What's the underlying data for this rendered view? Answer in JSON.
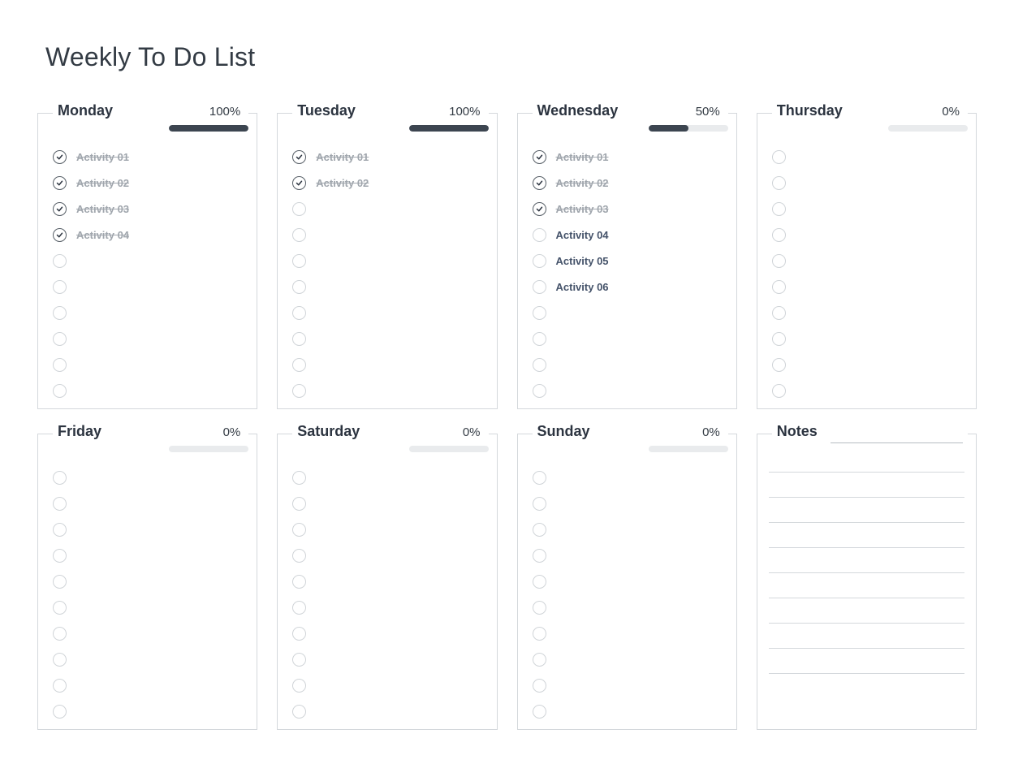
{
  "title": "Weekly To Do List",
  "notes_label": "Notes",
  "days": [
    {
      "name": "Monday",
      "percent": "100%",
      "progress": 100,
      "tasks": [
        {
          "label": "Activity 01",
          "done": true
        },
        {
          "label": "Activity 02",
          "done": true
        },
        {
          "label": "Activity 03",
          "done": true
        },
        {
          "label": "Activity 04",
          "done": true
        },
        {
          "label": "",
          "done": false
        },
        {
          "label": "",
          "done": false
        },
        {
          "label": "",
          "done": false
        },
        {
          "label": "",
          "done": false
        },
        {
          "label": "",
          "done": false
        },
        {
          "label": "",
          "done": false
        }
      ]
    },
    {
      "name": "Tuesday",
      "percent": "100%",
      "progress": 100,
      "tasks": [
        {
          "label": "Activity 01",
          "done": true
        },
        {
          "label": "Activity 02",
          "done": true
        },
        {
          "label": "",
          "done": false
        },
        {
          "label": "",
          "done": false
        },
        {
          "label": "",
          "done": false
        },
        {
          "label": "",
          "done": false
        },
        {
          "label": "",
          "done": false
        },
        {
          "label": "",
          "done": false
        },
        {
          "label": "",
          "done": false
        },
        {
          "label": "",
          "done": false
        }
      ]
    },
    {
      "name": "Wednesday",
      "percent": "50%",
      "progress": 50,
      "tasks": [
        {
          "label": "Activity 01",
          "done": true
        },
        {
          "label": "Activity 02",
          "done": true
        },
        {
          "label": "Activity 03",
          "done": true
        },
        {
          "label": "Activity 04",
          "done": false
        },
        {
          "label": "Activity 05",
          "done": false
        },
        {
          "label": "Activity 06",
          "done": false
        },
        {
          "label": "",
          "done": false
        },
        {
          "label": "",
          "done": false
        },
        {
          "label": "",
          "done": false
        },
        {
          "label": "",
          "done": false
        }
      ]
    },
    {
      "name": "Thursday",
      "percent": "0%",
      "progress": 0,
      "tasks": [
        {
          "label": "",
          "done": false
        },
        {
          "label": "",
          "done": false
        },
        {
          "label": "",
          "done": false
        },
        {
          "label": "",
          "done": false
        },
        {
          "label": "",
          "done": false
        },
        {
          "label": "",
          "done": false
        },
        {
          "label": "",
          "done": false
        },
        {
          "label": "",
          "done": false
        },
        {
          "label": "",
          "done": false
        },
        {
          "label": "",
          "done": false
        }
      ]
    },
    {
      "name": "Friday",
      "percent": "0%",
      "progress": 0,
      "tasks": [
        {
          "label": "",
          "done": false
        },
        {
          "label": "",
          "done": false
        },
        {
          "label": "",
          "done": false
        },
        {
          "label": "",
          "done": false
        },
        {
          "label": "",
          "done": false
        },
        {
          "label": "",
          "done": false
        },
        {
          "label": "",
          "done": false
        },
        {
          "label": "",
          "done": false
        },
        {
          "label": "",
          "done": false
        },
        {
          "label": "",
          "done": false
        }
      ]
    },
    {
      "name": "Saturday",
      "percent": "0%",
      "progress": 0,
      "tasks": [
        {
          "label": "",
          "done": false
        },
        {
          "label": "",
          "done": false
        },
        {
          "label": "",
          "done": false
        },
        {
          "label": "",
          "done": false
        },
        {
          "label": "",
          "done": false
        },
        {
          "label": "",
          "done": false
        },
        {
          "label": "",
          "done": false
        },
        {
          "label": "",
          "done": false
        },
        {
          "label": "",
          "done": false
        },
        {
          "label": "",
          "done": false
        }
      ]
    },
    {
      "name": "Sunday",
      "percent": "0%",
      "progress": 0,
      "tasks": [
        {
          "label": "",
          "done": false
        },
        {
          "label": "",
          "done": false
        },
        {
          "label": "",
          "done": false
        },
        {
          "label": "",
          "done": false
        },
        {
          "label": "",
          "done": false
        },
        {
          "label": "",
          "done": false
        },
        {
          "label": "",
          "done": false
        },
        {
          "label": "",
          "done": false
        },
        {
          "label": "",
          "done": false
        },
        {
          "label": "",
          "done": false
        }
      ]
    }
  ],
  "note_lines": 9
}
